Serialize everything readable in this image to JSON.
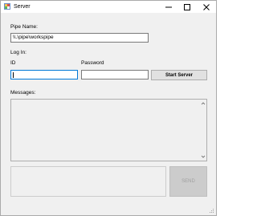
{
  "window": {
    "title": "Server"
  },
  "icons": {
    "app": "server-app-icon",
    "minimize": "minimize-icon",
    "maximize": "maximize-icon",
    "close": "close-icon"
  },
  "pipe": {
    "label": "Pipe Name:",
    "value": "\\\\.\\pipe\\workspipe"
  },
  "login": {
    "label": "Log In:",
    "id_label": "ID",
    "id_value": "",
    "password_label": "Password",
    "password_value": "",
    "start_button": "Start Server"
  },
  "messages": {
    "label": "Messages:",
    "content": ""
  },
  "send": {
    "input_value": "",
    "button": "SEND"
  },
  "colors": {
    "focus_border": "#0078d7",
    "window_bg": "#f0f0f0"
  }
}
